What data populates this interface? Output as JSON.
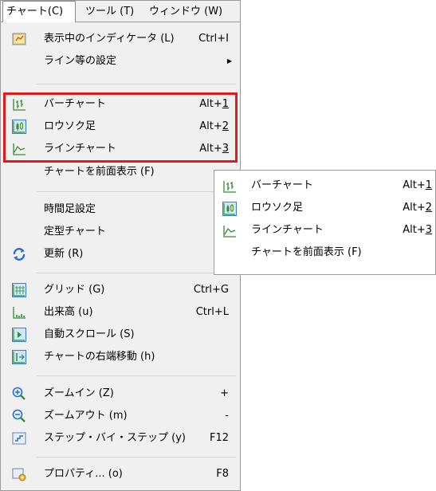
{
  "menubar": {
    "chart": "チャート(C)",
    "tools": "ツール (T)",
    "window": "ウィンドウ (W)"
  },
  "menu": {
    "indicators": {
      "label": "表示中のインディケータ (L)",
      "shortcut": "Ctrl+I"
    },
    "line_settings": {
      "label": "ライン等の設定"
    },
    "bar_chart": {
      "label": "バーチャート",
      "shortcut_prefix": "Alt+",
      "shortcut_key": "1"
    },
    "candlestick": {
      "label": "ロウソク足",
      "shortcut_prefix": "Alt+",
      "shortcut_key": "2"
    },
    "line_chart": {
      "label": "ラインチャート",
      "shortcut_prefix": "Alt+",
      "shortcut_key": "3"
    },
    "foreground": {
      "label": "チャートを前面表示 (F)"
    },
    "timeframe": {
      "label": "時間足設定"
    },
    "template": {
      "label": "定型チャート"
    },
    "refresh": {
      "label": "更新 (R)"
    },
    "grid": {
      "label": "グリッド (G)",
      "shortcut": "Ctrl+G"
    },
    "volume": {
      "label": "出来高 (u)",
      "shortcut": "Ctrl+L"
    },
    "autoscroll": {
      "label": "自動スクロール (S)"
    },
    "chart_shift": {
      "label": "チャートの右端移動 (h)"
    },
    "zoom_in": {
      "label": "ズームイン (Z)",
      "shortcut": "+"
    },
    "zoom_out": {
      "label": "ズームアウト (m)",
      "shortcut": "-"
    },
    "step": {
      "label": "ステップ・バイ・ステップ (y)",
      "shortcut": "F12"
    },
    "properties": {
      "label": "プロパティ... (o)",
      "shortcut": "F8"
    }
  },
  "submenu": {
    "bar_chart": {
      "label": "バーチャート",
      "shortcut_prefix": "Alt+",
      "shortcut_key": "1"
    },
    "candlestick": {
      "label": "ロウソク足",
      "shortcut_prefix": "Alt+",
      "shortcut_key": "2"
    },
    "line_chart": {
      "label": "ラインチャート",
      "shortcut_prefix": "Alt+",
      "shortcut_key": "3"
    },
    "foreground": {
      "label": "チャートを前面表示 (F)"
    }
  },
  "colors": {
    "highlight_border": "#e11b1b",
    "menu_bg": "#f0f0f0",
    "icon_green": "#2f8f2f",
    "icon_blue": "#2a6fd0"
  }
}
